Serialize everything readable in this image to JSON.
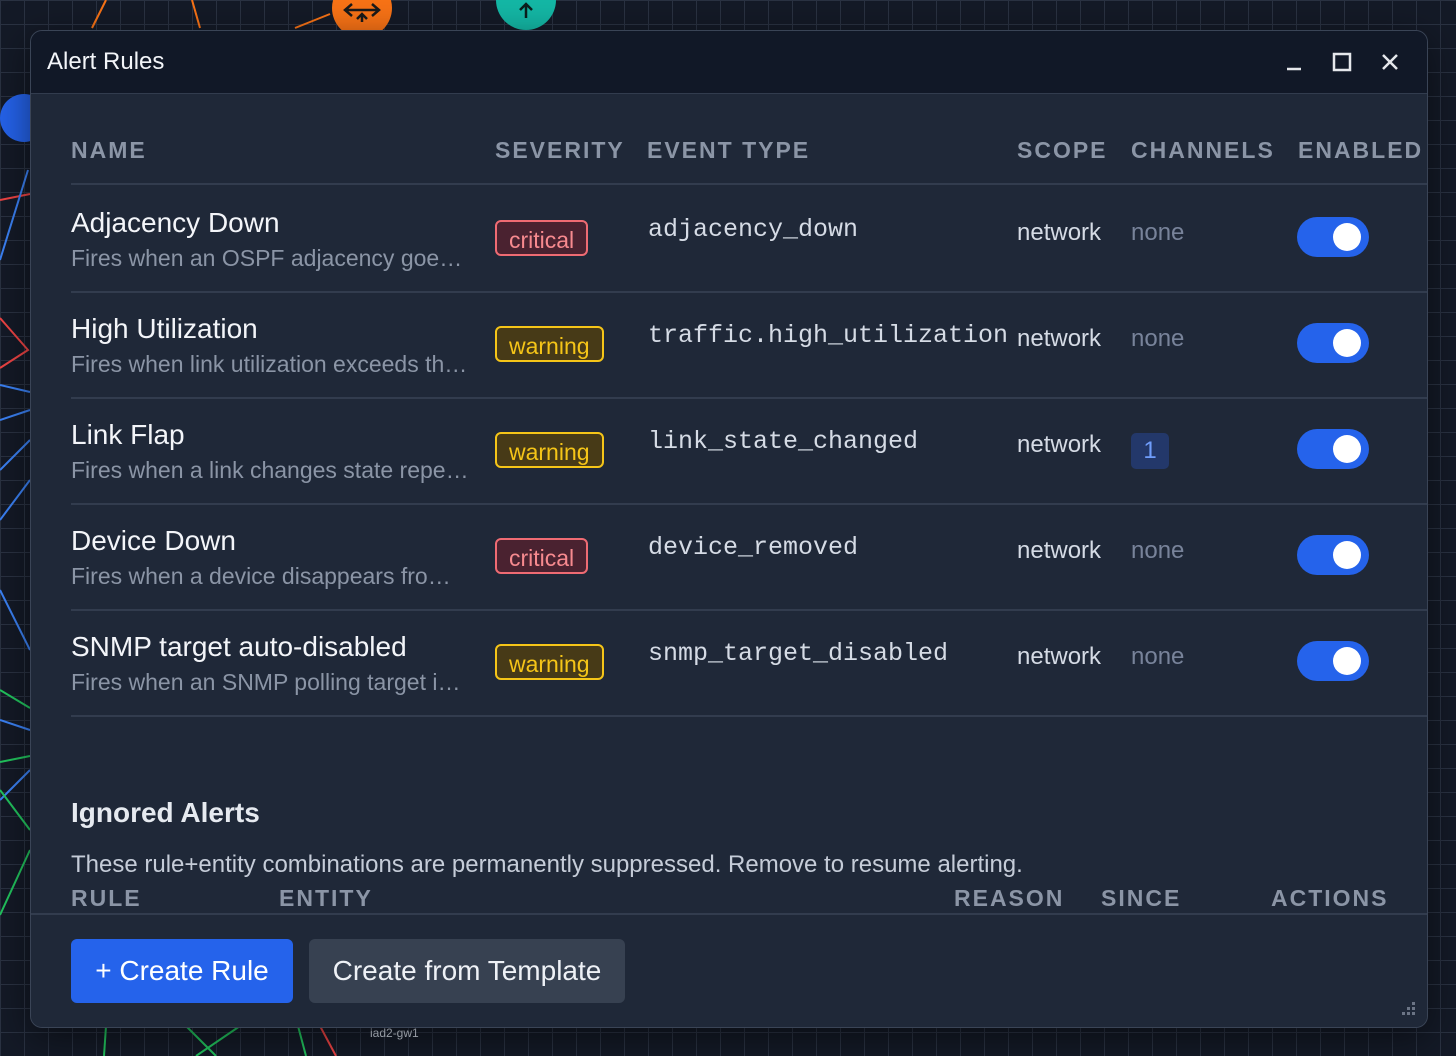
{
  "background": {
    "node_label": "iad2-gw1"
  },
  "window": {
    "title": "Alert Rules",
    "controls": [
      "minimize-icon",
      "maximize-icon",
      "close-icon"
    ]
  },
  "table": {
    "headers": {
      "name": "NAME",
      "severity": "SEVERITY",
      "event_type": "EVENT TYPE",
      "scope": "SCOPE",
      "channels": "CHANNELS",
      "enabled": "ENABLED"
    },
    "rows": [
      {
        "name": "Adjacency Down",
        "description": "Fires when an OSPF adjacency goes down",
        "severity": "critical",
        "event_type": "adjacency_down",
        "scope": "network",
        "channels": "none",
        "enabled": true
      },
      {
        "name": "High Utilization",
        "description": "Fires when link utilization exceeds the threshold",
        "severity": "warning",
        "event_type": "traffic.high_utilization",
        "scope": "network",
        "channels": "none",
        "enabled": true
      },
      {
        "name": "Link Flap",
        "description": "Fires when a link changes state repeatedly",
        "severity": "warning",
        "event_type": "link_state_changed",
        "scope": "network",
        "channels": "1",
        "enabled": true
      },
      {
        "name": "Device Down",
        "description": "Fires when a device disappears from the network",
        "severity": "critical",
        "event_type": "device_removed",
        "scope": "network",
        "channels": "none",
        "enabled": true
      },
      {
        "name": "SNMP target auto-disabled",
        "description": "Fires when an SNMP polling target is auto-disabled",
        "severity": "warning",
        "event_type": "snmp_target_disabled",
        "scope": "network",
        "channels": "none",
        "enabled": true
      }
    ]
  },
  "ignored": {
    "title": "Ignored Alerts",
    "description": "These rule+entity combinations are permanently suppressed. Remove to resume alerting.",
    "headers": {
      "rule": "RULE",
      "entity": "ENTITY",
      "reason": "REASON",
      "since": "SINCE",
      "actions": "ACTIONS"
    }
  },
  "footer": {
    "create_rule": "+ Create Rule",
    "create_from_template": "Create from Template"
  },
  "colors": {
    "accent": "#2563eb",
    "critical": "#ef6b73",
    "warning": "#f5c518",
    "window_bg": "#1f2838",
    "titlebar_bg": "#111827"
  }
}
